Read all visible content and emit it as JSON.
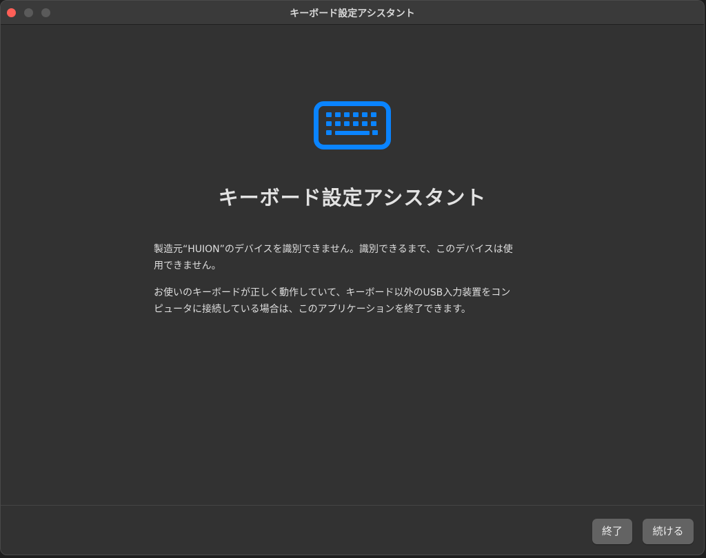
{
  "window": {
    "title": "キーボード設定アシスタント"
  },
  "main": {
    "icon": "keyboard-icon",
    "accent_color": "#0a84ff",
    "heading": "キーボード設定アシスタント",
    "paragraph1_line1": "製造元“HUION”のデバイスを識別できません。識別できるまで、このデバイスは使",
    "paragraph1_line2": "用できません。",
    "paragraph2_line1": "お使いのキーボードが正しく動作していて、キーボード以外のUSB入力装置をコン",
    "paragraph2_line2": "ピュータに接続している場合は、このアプリケーションを終了できます。"
  },
  "footer": {
    "quit_label": "終了",
    "continue_label": "続ける"
  }
}
